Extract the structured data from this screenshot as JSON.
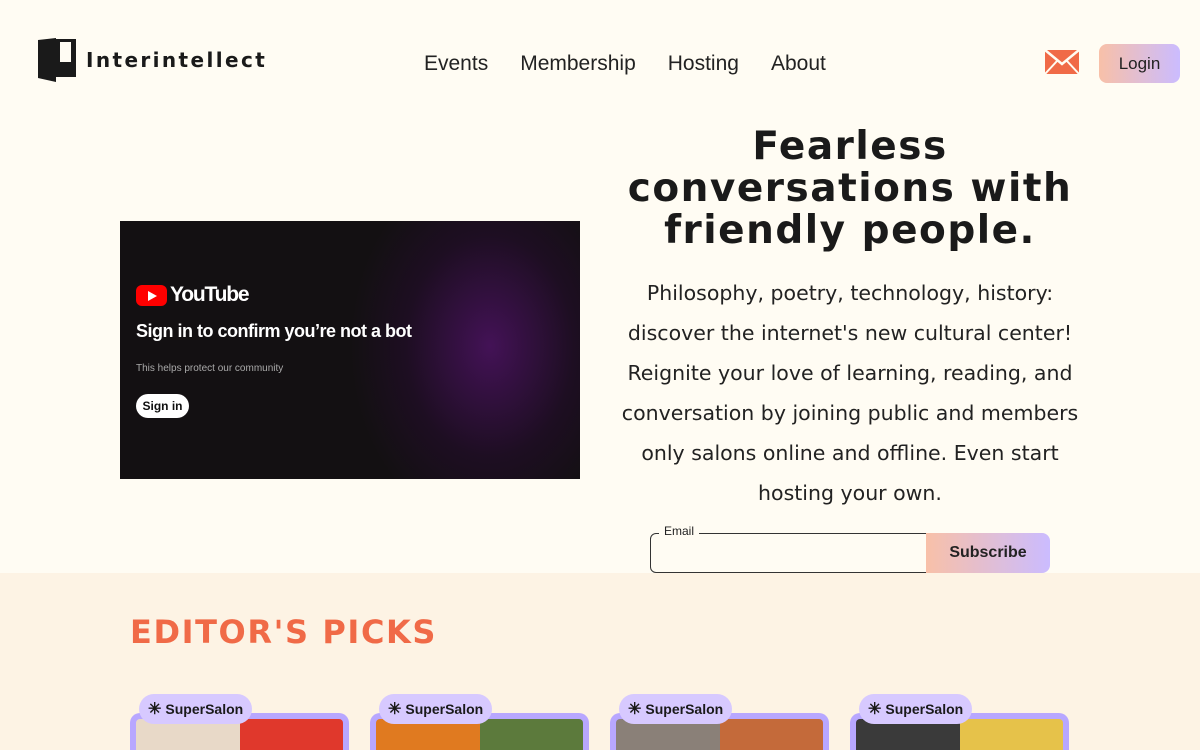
{
  "brand": {
    "name": "Interintellect"
  },
  "nav": {
    "items": [
      "Events",
      "Membership",
      "Hosting",
      "About"
    ]
  },
  "header": {
    "login_label": "Login",
    "mail_icon": "envelope-icon"
  },
  "video": {
    "logo_text": "YouTube",
    "title": "Sign in to confirm you’re not a bot",
    "subtitle": "This helps protect our community",
    "signin_label": "Sign in"
  },
  "hero": {
    "title": "Fearless conversations with friendly people.",
    "description": "Philosophy, poetry, technology, history: discover the internet's new cultural center! Reignite your love of learning, reading, and conversation by joining public and members only salons online and offline. Even start hosting your own."
  },
  "subscribe": {
    "email_label": "Email",
    "button_label": "Subscribe"
  },
  "picks": {
    "title": "EDITOR'S PICKS",
    "cards": [
      {
        "badge": "SuperSalon"
      },
      {
        "badge": "SuperSalon"
      },
      {
        "badge": "SuperSalon"
      },
      {
        "badge": "SuperSalon"
      }
    ]
  },
  "colors": {
    "accent": "#f06a47",
    "background": "#fffcf3",
    "picks_bg": "#fdf3e4",
    "badge": "#d7c9ff",
    "card_frame": "#b8a7ff"
  }
}
